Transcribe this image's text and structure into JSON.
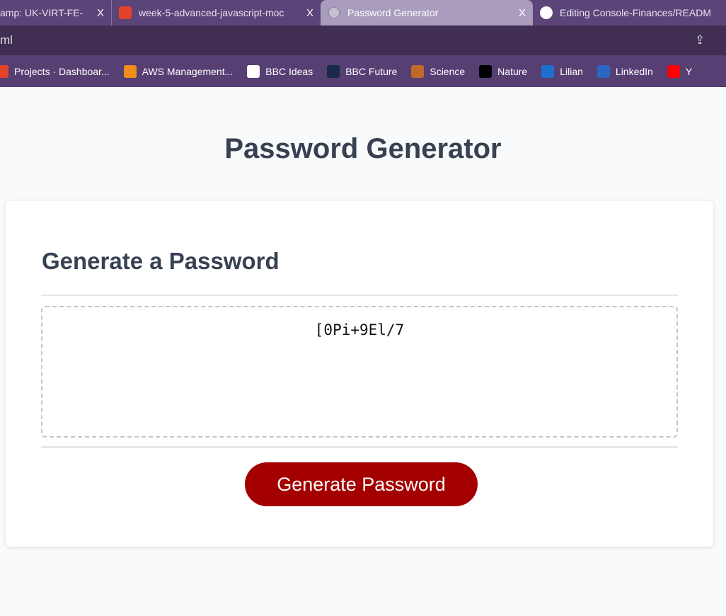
{
  "browser": {
    "tabs": [
      {
        "label": "amp: UK-VIRT-FE-",
        "icon": "bootcamp-icon",
        "color": "#5a4478"
      },
      {
        "label": "week-5-advanced-javascript-moc",
        "icon": "gitlab-icon",
        "color": "#e2432a"
      },
      {
        "label": "Password Generator",
        "icon": "globe-icon",
        "color": "#c7bfd3",
        "active": true
      },
      {
        "label": "Editing Console-Finances/READM",
        "icon": "github-icon",
        "color": "#ffffff"
      }
    ],
    "close_glyph": "X",
    "address": "ml",
    "bookmarks": [
      {
        "label": "Projects · Dashboar...",
        "color": "#e2432a"
      },
      {
        "label": "AWS Management...",
        "color": "#f08c1a"
      },
      {
        "label": "BBC Ideas",
        "color": "#ffffff"
      },
      {
        "label": "BBC Future",
        "color": "#1a2a4a"
      },
      {
        "label": "Science",
        "color": "#c06a2a"
      },
      {
        "label": "Nature",
        "color": "#000000"
      },
      {
        "label": "Lilian",
        "color": "#1f6fd0"
      },
      {
        "label": "LinkedIn",
        "color": "#2a66c2"
      },
      {
        "label": "Y",
        "color": "#ff0000"
      }
    ]
  },
  "page": {
    "title": "Password Generator",
    "card_title": "Generate a Password",
    "password": "[0Pi+9El/7",
    "button": "Generate Password",
    "accent": "#a50000"
  }
}
